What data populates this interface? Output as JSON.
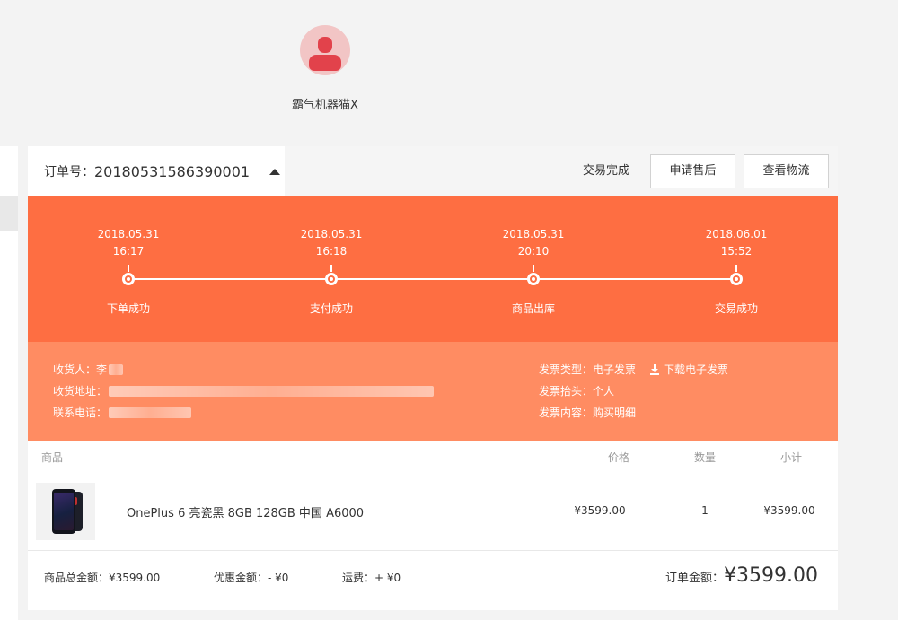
{
  "user": {
    "name": "霸气机器猫X"
  },
  "order": {
    "number_label": "订单号：",
    "number": "20180531586390001",
    "status": "交易完成",
    "actions": {
      "after_sale": "申请售后",
      "logistics": "查看物流"
    }
  },
  "timeline": [
    {
      "date": "2018.05.31",
      "time": "16:17",
      "label": "下单成功"
    },
    {
      "date": "2018.05.31",
      "time": "16:18",
      "label": "支付成功"
    },
    {
      "date": "2018.05.31",
      "time": "20:10",
      "label": "商品出库"
    },
    {
      "date": "2018.06.01",
      "time": "15:52",
      "label": "交易成功"
    }
  ],
  "recipient": {
    "name_label": "收货人：",
    "name_visible": "李",
    "address_label": "收货地址：",
    "phone_label": "联系电话："
  },
  "invoice": {
    "type_label": "发票类型：",
    "type": "电子发票",
    "download": "下载电子发票",
    "title_label": "发票抬头：",
    "title": "个人",
    "content_label": "发票内容：",
    "content": "购买明细"
  },
  "goods": {
    "headers": {
      "product": "商品",
      "price": "价格",
      "quantity": "数量",
      "subtotal": "小计"
    },
    "items": [
      {
        "name": "OnePlus 6 亮瓷黑 8GB 128GB 中国 A6000",
        "price": "¥3599.00",
        "quantity": "1",
        "subtotal": "¥3599.00"
      }
    ]
  },
  "summary": {
    "goods_total": "商品总金额：¥3599.00",
    "discount": "优惠金额：- ¥0",
    "shipping": "运费：+ ¥0",
    "order_total_label": "订单金额：",
    "order_total": "¥3599.00"
  },
  "colors": {
    "timeline_bg": "#fe6e42",
    "info_bg": "#ff8c62",
    "avatar_bg": "#f2c5c5",
    "avatar_fg": "#e2424b"
  }
}
